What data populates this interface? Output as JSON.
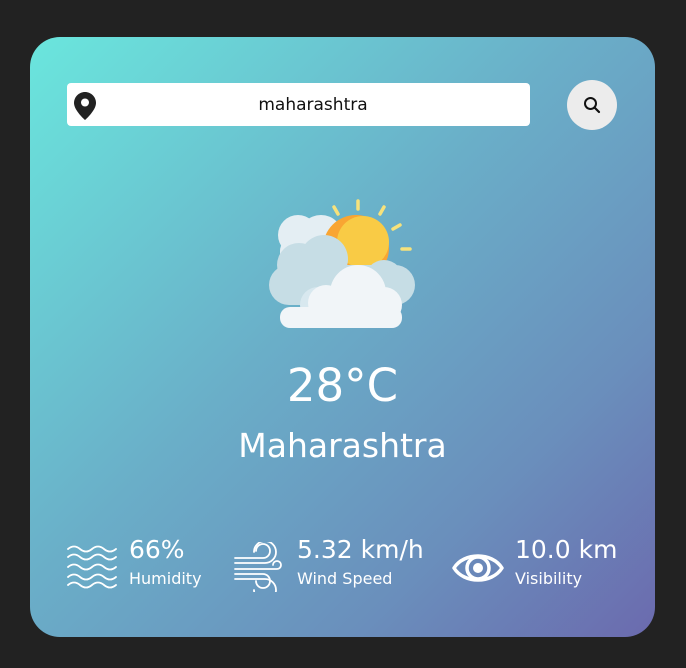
{
  "search": {
    "value": "maharashtra",
    "location_icon": "map-pin-icon",
    "button_icon": "search-icon"
  },
  "weather": {
    "icon": "partly-cloudy-sun-icon",
    "temperature": "28°C",
    "city": "Maharashtra"
  },
  "stats": {
    "humidity": {
      "value": "66%",
      "label": "Humidity",
      "icon": "waves-icon"
    },
    "wind": {
      "value": "5.32 km/h",
      "label": "Wind Speed",
      "icon": "wind-icon"
    },
    "visibility": {
      "value": "10.0 km",
      "label": "Visibility",
      "icon": "eye-icon"
    }
  },
  "colors": {
    "card_gradient_start": "#6ae6dd",
    "card_gradient_end": "#6b6aae",
    "page_background": "#222222",
    "text": "#ffffff"
  }
}
